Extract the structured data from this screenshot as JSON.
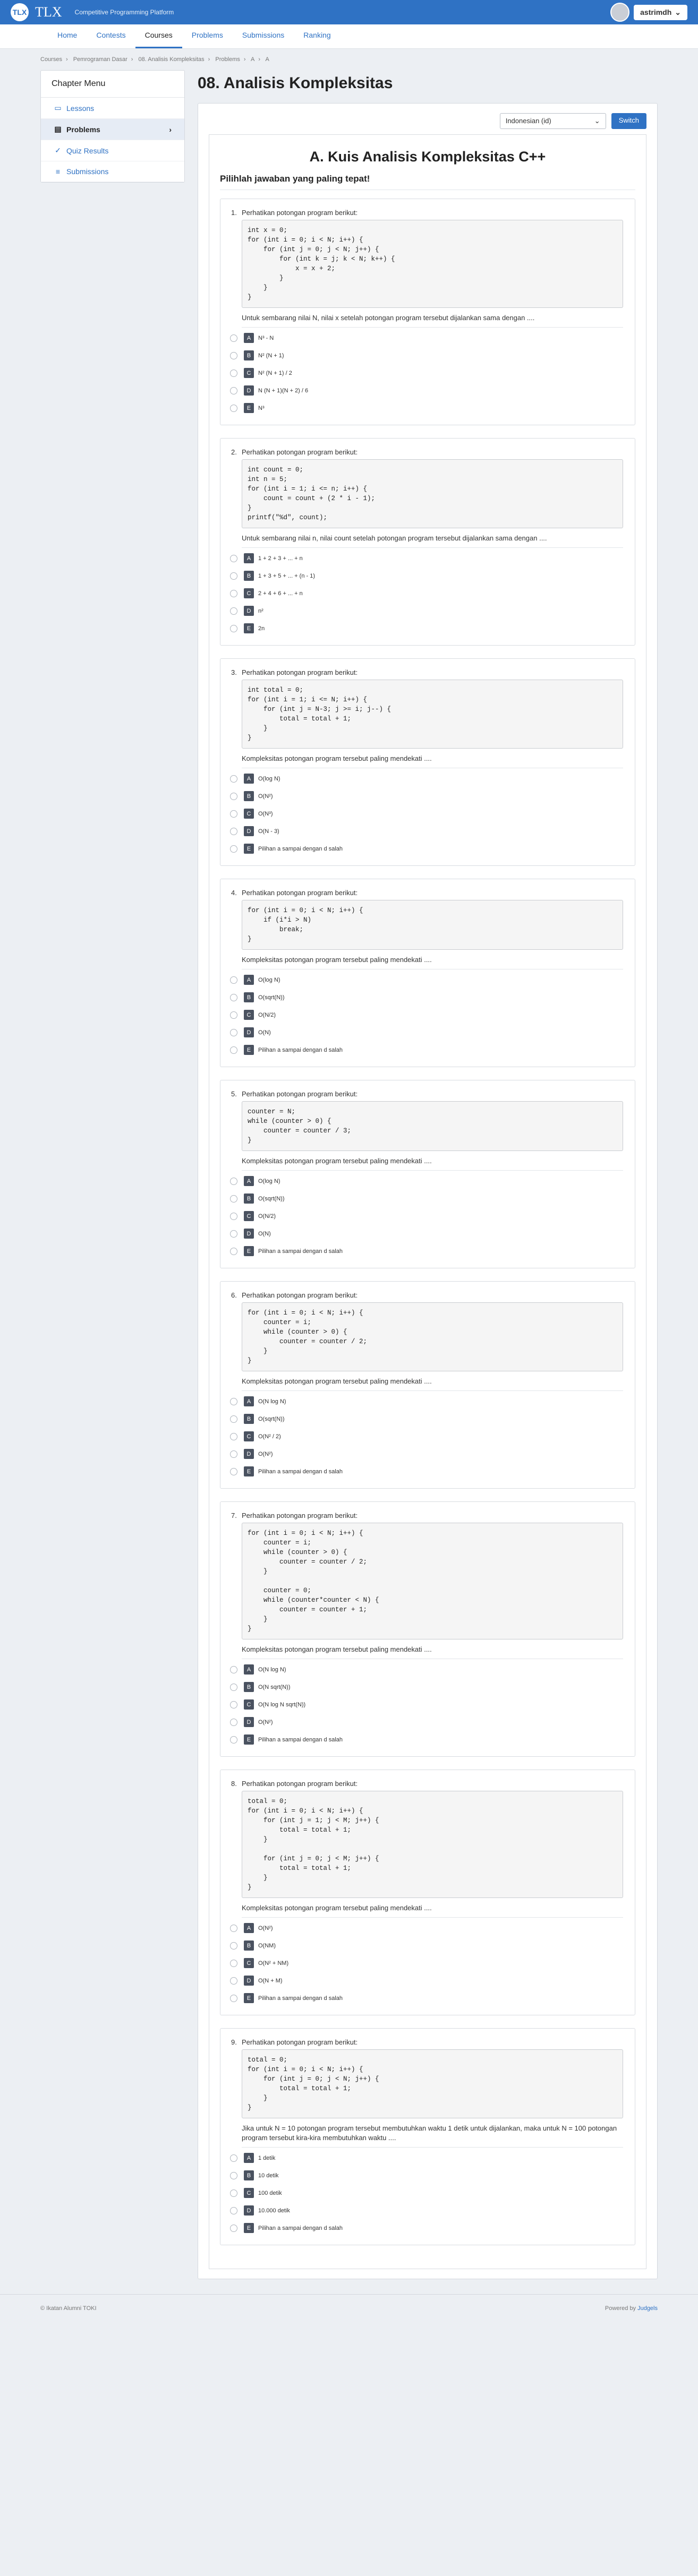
{
  "header": {
    "logo_mark": "TLX",
    "logo_text": "TLX",
    "tagline": "Competitive Programming Platform",
    "username": "astrimdh"
  },
  "nav": [
    "Home",
    "Contests",
    "Courses",
    "Problems",
    "Submissions",
    "Ranking"
  ],
  "breadcrumb": [
    "Courses",
    "Pemrograman Dasar",
    "08. Analisis Kompleksitas",
    "Problems",
    "A",
    "A"
  ],
  "sidebar": {
    "title": "Chapter Menu",
    "items": [
      {
        "label": "Lessons",
        "icon": "book-icon"
      },
      {
        "label": "Problems",
        "icon": "problems-icon"
      },
      {
        "label": "Quiz Results",
        "icon": "results-icon"
      },
      {
        "label": "Submissions",
        "icon": "submissions-icon"
      }
    ]
  },
  "page_title": "08. Analisis Kompleksitas",
  "language": {
    "selected": "Indonesian (id)",
    "switch_label": "Switch"
  },
  "quiz_title": "A. Kuis Analisis Kompleksitas C++",
  "instruction": "Pilihlah jawaban yang paling tepat!",
  "problems": [
    {
      "num": "1.",
      "prompt": "Perhatikan potongan program berikut:",
      "code": "int x = 0;\nfor (int i = 0; i < N; i++) {\n    for (int j = 0; j < N; j++) {\n        for (int k = j; k < N; k++) {\n            x = x + 2;\n        }\n    }\n}",
      "question": "Untuk sembarang nilai N, nilai x setelah potongan program tersebut dijalankan sama dengan ....",
      "options": [
        {
          "key": "A",
          "text": "N³ - N"
        },
        {
          "key": "B",
          "text": "N² (N + 1)"
        },
        {
          "key": "C",
          "text": "N² (N + 1) / 2"
        },
        {
          "key": "D",
          "text": "N (N + 1)(N + 2) / 6"
        },
        {
          "key": "E",
          "text": "N³"
        }
      ]
    },
    {
      "num": "2.",
      "prompt": "Perhatikan potongan program berikut:",
      "code": "int count = 0;\nint n = 5;\nfor (int i = 1; i <= n; i++) {\n    count = count + (2 * i - 1);\n}\nprintf(\"%d\", count);",
      "question": "Untuk sembarang nilai n, nilai count setelah potongan program tersebut dijalankan sama dengan ....",
      "options": [
        {
          "key": "A",
          "text": "1 + 2 + 3 + ... + n"
        },
        {
          "key": "B",
          "text": "1 + 3 + 5 + ... + (n - 1)"
        },
        {
          "key": "C",
          "text": "2 + 4 + 6 + ... + n"
        },
        {
          "key": "D",
          "text": "n²"
        },
        {
          "key": "E",
          "text": "2n"
        }
      ]
    },
    {
      "num": "3.",
      "prompt": "Perhatikan potongan program berikut:",
      "code": "int total = 0;\nfor (int i = 1; i <= N; i++) {\n    for (int j = N-3; j >= i; j--) {\n        total = total + 1;\n    }\n}",
      "question": "Kompleksitas potongan program tersebut paling mendekati ....",
      "options": [
        {
          "key": "A",
          "text": "O(log N)"
        },
        {
          "key": "B",
          "text": "O(N²)"
        },
        {
          "key": "C",
          "text": "O(N³)"
        },
        {
          "key": "D",
          "text": "O(N - 3)"
        },
        {
          "key": "E",
          "text": "Pilihan a sampai dengan d salah"
        }
      ]
    },
    {
      "num": "4.",
      "prompt": "Perhatikan potongan program berikut:",
      "code": "for (int i = 0; i < N; i++) {\n    if (i*i > N)\n        break;\n}",
      "question": "Kompleksitas potongan program tersebut paling mendekati ....",
      "options": [
        {
          "key": "A",
          "text": "O(log N)"
        },
        {
          "key": "B",
          "text": "O(sqrt(N))"
        },
        {
          "key": "C",
          "text": "O(N/2)"
        },
        {
          "key": "D",
          "text": "O(N)"
        },
        {
          "key": "E",
          "text": "Pilihan a sampai dengan d salah"
        }
      ]
    },
    {
      "num": "5.",
      "prompt": "Perhatikan potongan program berikut:",
      "code": "counter = N;\nwhile (counter > 0) {\n    counter = counter / 3;\n}",
      "question": "Kompleksitas potongan program tersebut paling mendekati ....",
      "options": [
        {
          "key": "A",
          "text": "O(log N)"
        },
        {
          "key": "B",
          "text": "O(sqrt(N))"
        },
        {
          "key": "C",
          "text": "O(N/2)"
        },
        {
          "key": "D",
          "text": "O(N)"
        },
        {
          "key": "E",
          "text": "Pilihan a sampai dengan d salah"
        }
      ]
    },
    {
      "num": "6.",
      "prompt": "Perhatikan potongan program berikut:",
      "code": "for (int i = 0; i < N; i++) {\n    counter = i;\n    while (counter > 0) {\n        counter = counter / 2;\n    }\n}",
      "question": "Kompleksitas potongan program tersebut paling mendekati ....",
      "options": [
        {
          "key": "A",
          "text": "O(N log N)"
        },
        {
          "key": "B",
          "text": "O(sqrt(N))"
        },
        {
          "key": "C",
          "text": "O(N² / 2)"
        },
        {
          "key": "D",
          "text": "O(N²)"
        },
        {
          "key": "E",
          "text": "Pilihan a sampai dengan d salah"
        }
      ]
    },
    {
      "num": "7.",
      "prompt": "Perhatikan potongan program berikut:",
      "code": "for (int i = 0; i < N; i++) {\n    counter = i;\n    while (counter > 0) {\n        counter = counter / 2;\n    }\n\n    counter = 0;\n    while (counter*counter < N) {\n        counter = counter + 1;\n    }\n}",
      "question": "Kompleksitas potongan program tersebut paling mendekati ....",
      "options": [
        {
          "key": "A",
          "text": "O(N log N)"
        },
        {
          "key": "B",
          "text": "O(N sqrt(N))"
        },
        {
          "key": "C",
          "text": "O(N log N sqrt(N))"
        },
        {
          "key": "D",
          "text": "O(N²)"
        },
        {
          "key": "E",
          "text": "Pilihan a sampai dengan d salah"
        }
      ]
    },
    {
      "num": "8.",
      "prompt": "Perhatikan potongan program berikut:",
      "code": "total = 0;\nfor (int i = 0; i < N; i++) {\n    for (int j = 1; j < M; j++) {\n        total = total + 1;\n    }\n\n    for (int j = 0; j < M; j++) {\n        total = total + 1;\n    }\n}",
      "question": "Kompleksitas potongan program tersebut paling mendekati ....",
      "options": [
        {
          "key": "A",
          "text": "O(N²)"
        },
        {
          "key": "B",
          "text": "O(NM)"
        },
        {
          "key": "C",
          "text": "O(N² + NM)"
        },
        {
          "key": "D",
          "text": "O(N + M)"
        },
        {
          "key": "E",
          "text": "Pilihan a sampai dengan d salah"
        }
      ]
    },
    {
      "num": "9.",
      "prompt": "Perhatikan potongan program berikut:",
      "code": "total = 0;\nfor (int i = 0; i < N; i++) {\n    for (int j = 0; j < N; j++) {\n        total = total + 1;\n    }\n}",
      "question": "Jika untuk N = 10 potongan program tersebut membutuhkan waktu 1 detik untuk dijalankan, maka untuk N = 100 potongan program tersebut kira-kira membutuhkan waktu ....",
      "options": [
        {
          "key": "A",
          "text": "1 detik"
        },
        {
          "key": "B",
          "text": "10 detik"
        },
        {
          "key": "C",
          "text": "100 detik"
        },
        {
          "key": "D",
          "text": "10.000 detik"
        },
        {
          "key": "E",
          "text": "Pilihan a sampai dengan d salah"
        }
      ]
    }
  ],
  "footer": {
    "copyright": "© Ikatan Alumni TOKI",
    "powered_prefix": "Powered by",
    "powered_link": "Judgels"
  }
}
